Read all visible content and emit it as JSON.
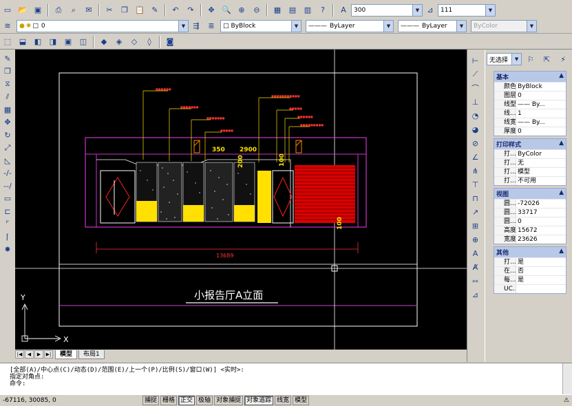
{
  "toolbar_row1": {
    "textstyle_value": "300",
    "dimscale_value": "111"
  },
  "toolbar_row2": {
    "layer_value": "0",
    "color_value": "ByBlock",
    "linetype_value": "ByLayer",
    "lineweight_value": "ByLayer",
    "plotstyle_value": "ByColor"
  },
  "drawing": {
    "title": "小报告厅A立面",
    "dim_total": "13689",
    "dim_a": "350",
    "dim_b": "2900",
    "dim_c": "200",
    "dim_d": "100",
    "dim_e": "100",
    "axis_x": "X",
    "axis_y": "Y"
  },
  "layout_tabs": {
    "model": "模型",
    "layout1": "布局1"
  },
  "properties": {
    "selection": "无选择",
    "basic": {
      "title": "基本",
      "rows": [
        {
          "k": "颜色",
          "v": "ByBlock"
        },
        {
          "k": "图层",
          "v": "0"
        },
        {
          "k": "线型",
          "v": "—— By..."
        },
        {
          "k": "线...",
          "v": "1"
        },
        {
          "k": "线宽",
          "v": "—— By..."
        },
        {
          "k": "厚度",
          "v": "0"
        }
      ]
    },
    "plot": {
      "title": "打印样式",
      "rows": [
        {
          "k": "打...",
          "v": "ByColor"
        },
        {
          "k": "打...",
          "v": "无"
        },
        {
          "k": "打...",
          "v": "模型"
        },
        {
          "k": "打...",
          "v": "不可用"
        }
      ]
    },
    "view": {
      "title": "视图",
      "rows": [
        {
          "k": "圆...",
          "v": "-72026"
        },
        {
          "k": "圆...",
          "v": "33717"
        },
        {
          "k": "圆...",
          "v": "0"
        },
        {
          "k": "高度",
          "v": "15672"
        },
        {
          "k": "宽度",
          "v": "23626"
        }
      ]
    },
    "misc": {
      "title": "其他",
      "rows": [
        {
          "k": "打...",
          "v": "是"
        },
        {
          "k": "在...",
          "v": "否"
        },
        {
          "k": "每...",
          "v": "是"
        },
        {
          "k": "UC...",
          "v": ""
        }
      ]
    }
  },
  "command": {
    "line1": "[全部(A)/中心点(C)/动态(D)/范围(E)/上一个(P)/比例(S)/窗口(W)] <实时>:",
    "line2": "指定对角点:",
    "line3": "命令:"
  },
  "status": {
    "coords": "-67116, 30085, 0",
    "buttons": [
      "捕捉",
      "栅格",
      "正交",
      "极轴",
      "对象捕捉",
      "对象追踪",
      "线宽",
      "模型"
    ]
  }
}
